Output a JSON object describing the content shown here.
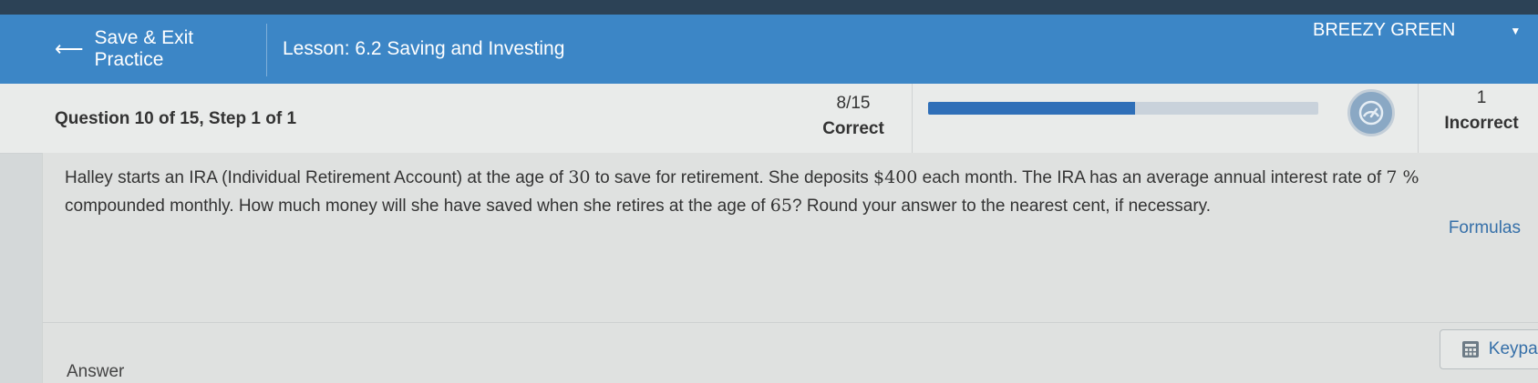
{
  "header": {
    "back_label": "Save & Exit Practice",
    "lesson": "Lesson: 6.2 Saving and Investing",
    "user_name": "BREEZY GREEN"
  },
  "status": {
    "question_label": "Question 10 of 15, Step 1 of 1",
    "score": "8/15",
    "score_label": "Correct",
    "progress_fraction": 0.53,
    "incorrect_count": "1",
    "incorrect_label": "Incorrect"
  },
  "question": {
    "text_a": "Halley starts an IRA (Individual Retirement Account) at the age of ",
    "age_start": "30",
    "text_b": " to save for retirement. She deposits ",
    "deposit": "$400",
    "text_c": " each month. The IRA has an average annual interest rate of ",
    "rate": "7 %",
    "text_d": " compounded monthly. How much money will she have saved when she retires at the age of ",
    "age_end": "65",
    "text_e": "? Round your answer to the nearest cent, if necessary."
  },
  "links": {
    "formulas": "Formulas"
  },
  "answer": {
    "label": "Answer",
    "keypad_label": "Keypad"
  },
  "icons": {
    "back": "arrow-left-icon",
    "dropdown": "caret-down-icon",
    "gauge": "gauge-icon",
    "keypad": "keypad-icon"
  }
}
